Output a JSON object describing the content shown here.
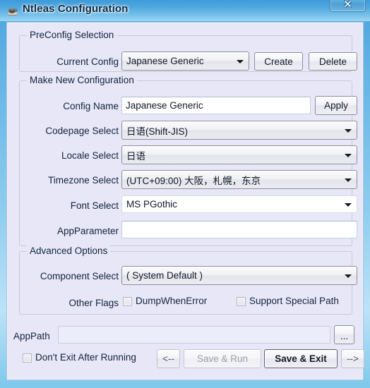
{
  "window": {
    "title": "Ntleas Configuration",
    "icon": "coffee-cup-icon",
    "close_label": "✕",
    "frame_color": "#4aa3dd",
    "client_bg": "#e7e7f8"
  },
  "preconfig_group": {
    "title": "PreConfig Selection",
    "current_config_label": "Current Config",
    "current_config_value": "Japanese Generic",
    "create_label": "Create",
    "delete_label": "Delete"
  },
  "make_new_group": {
    "title": "Make New Configuration",
    "config_name_label": "Config Name",
    "config_name_value": "Japanese Generic",
    "apply_label": "Apply",
    "codepage_label": "Codepage Select",
    "codepage_value": "日语(Shift-JIS)",
    "locale_label": "Locale Select",
    "locale_value": "日语",
    "timezone_label": "Timezone Select",
    "timezone_value": "(UTC+09:00) 大阪，札幌，东京",
    "font_label": "Font Select",
    "font_value": "MS PGothic",
    "appparameter_label": "AppParameter",
    "appparameter_value": ""
  },
  "advanced_group": {
    "title": "Advanced Options",
    "component_label": "Component Select",
    "component_value": "( System Default )",
    "other_flags_label": "Other Flags",
    "dump_when_error_label": "DumpWhenError",
    "support_special_path_label": "Support Special Path"
  },
  "footer": {
    "apppath_label": "AppPath",
    "apppath_value": "",
    "browse_label": "...",
    "dont_exit_label": "Don't Exit After Running",
    "back_label": "<--",
    "save_run_label": "Save & Run",
    "save_exit_label": "Save & Exit",
    "forward_label": "-->"
  }
}
